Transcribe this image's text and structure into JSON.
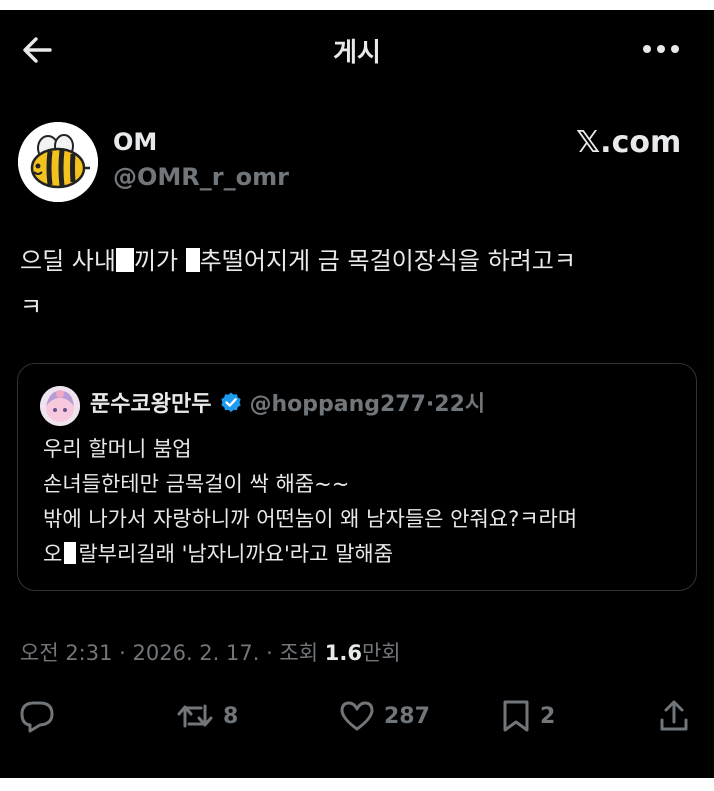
{
  "header": {
    "title": "게시"
  },
  "author": {
    "name": "OM",
    "handle": "@OMR_r_omr",
    "source": "𝕏.com"
  },
  "tweet": {
    "part1": "으딜 사내",
    "part2": "끼가 ",
    "part3": "추떨어지게 금 목걸이장식을 하려고ㅋ",
    "part4": "ㅋ"
  },
  "quote": {
    "name": "푼수코왕만두",
    "handle": "@hoppang277",
    "dot": "·",
    "time": "22시",
    "lines": [
      "우리 할머니 붐업",
      "손녀들한테만 금목걸이 싹 해줌~~",
      "밖에 나가서 자랑하니까 어떤놈이 왜 남자들은 안줘요?ㅋ라며"
    ],
    "last_line_a": "오",
    "last_line_b": "랄부리길래 '남자니까요'라고 말해줌"
  },
  "meta": {
    "time": "오전 2:31 · 2026. 2. 17. · 조회 ",
    "views": "1.6",
    "views_unit": "만회"
  },
  "actions": {
    "replies": "",
    "retweets": "8",
    "likes": "287",
    "bookmarks": "2"
  },
  "colors": {
    "background": "#000000",
    "text": "#e7e9ea",
    "secondary": "#71767b",
    "verified": "#1d9bf0",
    "border": "#2f3336"
  }
}
